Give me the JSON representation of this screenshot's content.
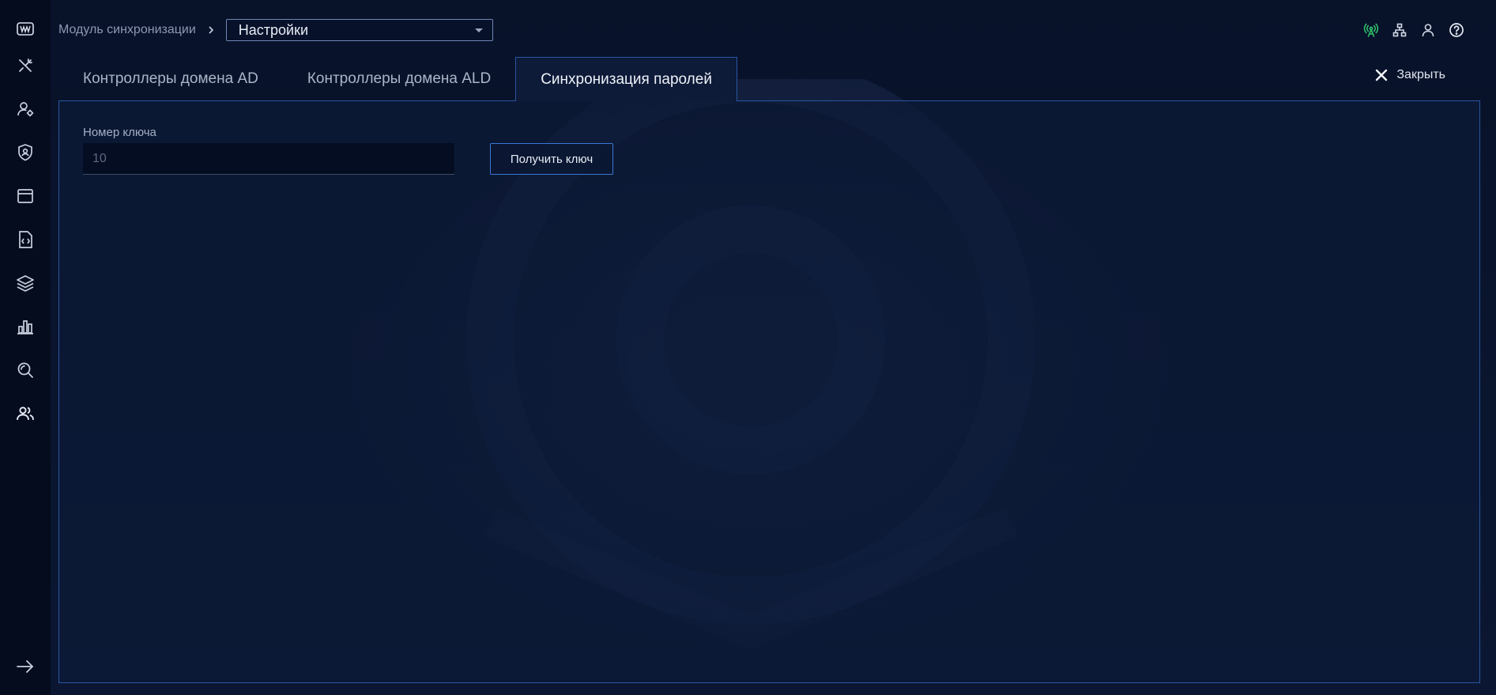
{
  "theme": {
    "accent": "#3a78d4",
    "status_ok": "#2fbf6a",
    "background": "#0b1631"
  },
  "sidebar": {
    "logo_icon": "app-logo-icon",
    "items": [
      {
        "name": "tools",
        "icon": "tools-icon"
      },
      {
        "name": "user-settings",
        "icon": "user-gear-icon"
      },
      {
        "name": "security",
        "icon": "shield-user-icon"
      },
      {
        "name": "window",
        "icon": "window-icon"
      },
      {
        "name": "code-file",
        "icon": "code-file-icon"
      },
      {
        "name": "layers",
        "icon": "layers-icon"
      },
      {
        "name": "reports",
        "icon": "bar-chart-icon"
      },
      {
        "name": "search",
        "icon": "search-icon"
      },
      {
        "name": "users",
        "icon": "users-icon"
      }
    ],
    "expand_icon": "arrow-right-icon"
  },
  "header": {
    "breadcrumb_root": "Модуль синхронизации",
    "section_select": {
      "value": "Настройки"
    },
    "icons": [
      "antenna-icon",
      "network-icon",
      "user-icon",
      "help-icon"
    ]
  },
  "tabs": [
    {
      "label": "Контроллеры домена AD",
      "active": false
    },
    {
      "label": "Контроллеры домена ALD",
      "active": false
    },
    {
      "label": "Синхронизация паролей",
      "active": true
    }
  ],
  "close": {
    "label": "Закрыть"
  },
  "form": {
    "key_number_label": "Номер ключа",
    "key_number_placeholder": "10",
    "key_number_value": "",
    "get_key_button": "Получить ключ"
  }
}
